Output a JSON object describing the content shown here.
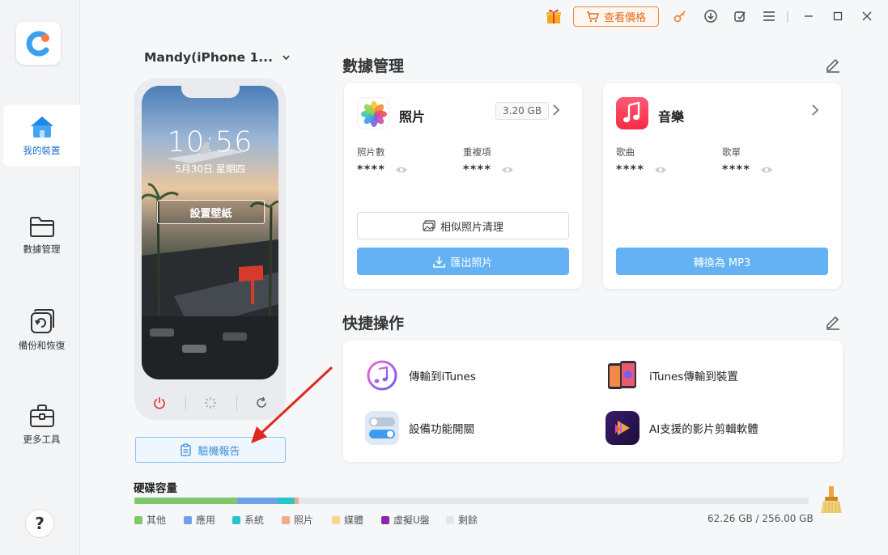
{
  "sidebar": {
    "items": [
      {
        "label": "我的裝置",
        "icon": "home-icon",
        "active": true
      },
      {
        "label": "數據管理",
        "icon": "folder-icon"
      },
      {
        "label": "備份和恢復",
        "icon": "backup-icon"
      },
      {
        "label": "更多工具",
        "icon": "toolbox-icon"
      }
    ],
    "help_label": "?"
  },
  "titlebar": {
    "price_label": "查看價格"
  },
  "device": {
    "name": "Mandy(iPhone 1...",
    "time": "10:56",
    "date": "5月30日 星期四",
    "wallpaper_label": "設置壁紙",
    "report_label": "驗機報告"
  },
  "data_management": {
    "title": "數據管理",
    "photos": {
      "title": "照片",
      "size": "3.20 GB",
      "stat1_label": "照片數",
      "stat1_value": "****",
      "stat2_label": "重複項",
      "stat2_value": "****",
      "btn_clean": "相似照片清理",
      "btn_export": "匯出照片"
    },
    "music": {
      "title": "音樂",
      "stat1_label": "歌曲",
      "stat1_value": "****",
      "stat2_label": "歌單",
      "stat2_value": "****",
      "btn_convert": "轉換為 MP3"
    }
  },
  "quick_actions": {
    "title": "快捷操作",
    "items": [
      {
        "label": "傳輸到iTunes"
      },
      {
        "label": "iTunes傳輸到裝置"
      },
      {
        "label": "設備功能開關"
      },
      {
        "label": "AI支援的影片剪輯軟體"
      }
    ]
  },
  "storage": {
    "title": "硬碟容量",
    "used_text": "62.26 GB / 256.00 GB",
    "segments": [
      {
        "label": "其他",
        "color": "#7cc86a",
        "fraction": 0.152
      },
      {
        "label": "應用",
        "color": "#6ea1ea",
        "fraction": 0.06
      },
      {
        "label": "系統",
        "color": "#27c4c8",
        "fraction": 0.026
      },
      {
        "label": "照片",
        "color": "#f4a98a",
        "fraction": 0.006
      },
      {
        "label": "媒體",
        "color": "#f7d58a",
        "fraction": 0.0
      },
      {
        "label": "虛擬U盤",
        "color": "#8e24aa",
        "fraction": 0.0
      },
      {
        "label": "剩餘",
        "color": "#e4e6e9",
        "fraction": 0.756
      }
    ]
  }
}
